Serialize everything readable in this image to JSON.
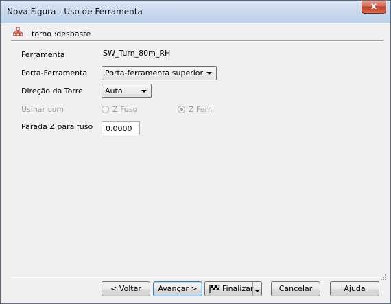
{
  "window": {
    "title": "Nova Figura - Uso de Ferramenta",
    "close_glyph": "x"
  },
  "header": {
    "icon": "tree-structure-icon",
    "label": "torno :desbaste"
  },
  "form": {
    "ferramenta": {
      "label": "Ferramenta",
      "value": "SW_Turn_80m_RH"
    },
    "porta": {
      "label": "Porta-Ferramenta",
      "value": "Porta-ferramenta superior"
    },
    "direcao": {
      "label": "Direção da Torre",
      "value": "Auto"
    },
    "usinar": {
      "label": "Usinar com",
      "option1": "Z Fuso",
      "option2": "Z Ferr.",
      "selected": "Z Ferr."
    },
    "parada": {
      "label": "Parada Z para fuso",
      "value": "0.0000"
    }
  },
  "buttons": {
    "voltar": "< Voltar",
    "avancar": "Avançar >",
    "finalizar": "Finalizar",
    "cancelar": "Cancelar",
    "ajuda": "Ajuda"
  },
  "colors": {
    "accent": "#3c7fb1",
    "icon_red": "#c0392b"
  }
}
